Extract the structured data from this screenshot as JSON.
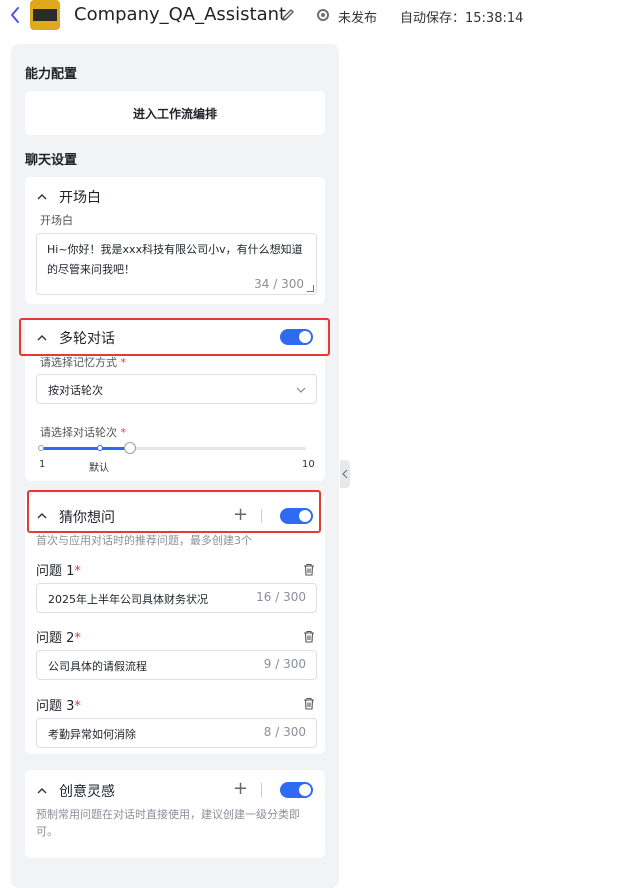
{
  "header": {
    "title": "Company_QA_Assistant",
    "status": "未发布",
    "autosave": "自动保存：15:38:14",
    "logo_text": "高·中·站号 社团"
  },
  "sections": {
    "capability": "能力配置",
    "chat": "聊天设置"
  },
  "workflow_button": "进入工作流编排",
  "opening": {
    "title": "开场白",
    "field_label": "开场白",
    "text": "Hi~你好！我是xxx科技有限公司小v，有什么想知道的尽管来问我吧！",
    "count": "34 / 300"
  },
  "multi_turn": {
    "title": "多轮对话",
    "enabled": true,
    "memory_label": "请选择记忆方式",
    "memory_value": "按对话轮次",
    "rounds_label": "请选择对话轮次",
    "slider_min": "1",
    "slider_default": "默认",
    "slider_max": "10",
    "slider_value": 4
  },
  "guess": {
    "title": "猜你想问",
    "enabled": true,
    "hint": "首次与应用对话时的推荐问题，最多创建3个",
    "questions": [
      {
        "label": "问题 1",
        "value": "2025年上半年公司具体财务状况",
        "count": "16 / 300"
      },
      {
        "label": "问题 2",
        "value": "公司具体的请假流程",
        "count": "9 / 300"
      },
      {
        "label": "问题 3",
        "value": "考勤异常如何消除",
        "count": "8 / 300"
      }
    ]
  },
  "inspiration": {
    "title": "创意灵感",
    "enabled": true,
    "hint": "预制常用问题在对话时直接使用，建议创建一级分类即可。"
  },
  "required_mark": "*",
  "colors": {
    "accent": "#2f6bf0",
    "highlight": "#e53935",
    "brand": "#4d53e8"
  }
}
